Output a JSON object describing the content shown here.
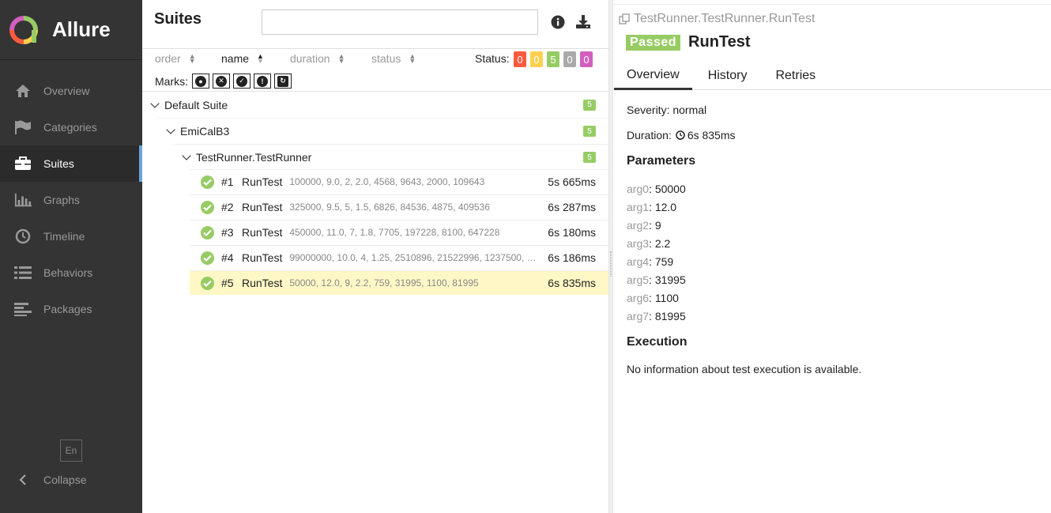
{
  "app": {
    "name": "Allure"
  },
  "sidebar": {
    "items": [
      {
        "label": "Overview",
        "icon": "home-icon"
      },
      {
        "label": "Categories",
        "icon": "flag-icon"
      },
      {
        "label": "Suites",
        "icon": "briefcase-icon",
        "active": true
      },
      {
        "label": "Graphs",
        "icon": "bar-chart-icon"
      },
      {
        "label": "Timeline",
        "icon": "clock-icon"
      },
      {
        "label": "Behaviors",
        "icon": "list-icon"
      },
      {
        "label": "Packages",
        "icon": "align-left-icon"
      }
    ],
    "language": "En",
    "collapse_label": "Collapse"
  },
  "suites": {
    "title": "Suites",
    "search": {
      "value": "",
      "placeholder": ""
    },
    "sort": {
      "order": "order",
      "name": "name",
      "duration": "duration",
      "status": "status"
    },
    "status_label": "Status:",
    "status_counts": [
      {
        "value": "0",
        "color": "#fd5a3e"
      },
      {
        "value": "0",
        "color": "#ffd050"
      },
      {
        "value": "5",
        "color": "#97cc64"
      },
      {
        "value": "0",
        "color": "#aaaaaa"
      },
      {
        "value": "0",
        "color": "#d35ebe"
      }
    ],
    "marks_label": "Marks:",
    "tree": {
      "suite": {
        "name": "Default Suite",
        "count": "5"
      },
      "package": {
        "name": "EmiCalB3",
        "count": "5"
      },
      "class": {
        "name": "TestRunner.TestRunner",
        "count": "5"
      }
    },
    "tests": [
      {
        "num": "#1",
        "name": "RunTest",
        "params": "100000, 9.0, 2, 2.0, 4568, 9643, 2000, 109643",
        "duration": "5s 665ms"
      },
      {
        "num": "#2",
        "name": "RunTest",
        "params": "325000, 9.5, 5, 1.5, 6826, 84536, 4875, 409536",
        "duration": "6s 287ms"
      },
      {
        "num": "#3",
        "name": "RunTest",
        "params": "450000, 11.0, 7, 1.8, 7705, 197228, 8100, 647228",
        "duration": "6s 180ms"
      },
      {
        "num": "#4",
        "name": "RunTest",
        "params": "99000000, 10.0, 4, 1.25, 2510896, 21522996, 1237500, 12...",
        "duration": "6s 186ms"
      },
      {
        "num": "#5",
        "name": "RunTest",
        "params": "50000, 12.0, 9, 2.2, 759, 31995, 1100, 81995",
        "duration": "6s 835ms",
        "selected": true
      }
    ]
  },
  "detail": {
    "breadcrumb": "TestRunner.TestRunner.RunTest",
    "status": "Passed",
    "title": "RunTest",
    "tabs": [
      "Overview",
      "History",
      "Retries"
    ],
    "severity": "Severity: normal",
    "duration_label": "Duration:",
    "duration": "6s 835ms",
    "parameters_title": "Parameters",
    "parameters": [
      {
        "name": "arg0",
        "value": "50000"
      },
      {
        "name": "arg1",
        "value": "12.0"
      },
      {
        "name": "arg2",
        "value": "9"
      },
      {
        "name": "arg3",
        "value": "2.2"
      },
      {
        "name": "arg4",
        "value": "759"
      },
      {
        "name": "arg5",
        "value": "31995"
      },
      {
        "name": "arg6",
        "value": "1100"
      },
      {
        "name": "arg7",
        "value": "81995"
      }
    ],
    "execution_title": "Execution",
    "execution_text": "No information about test execution is available."
  }
}
